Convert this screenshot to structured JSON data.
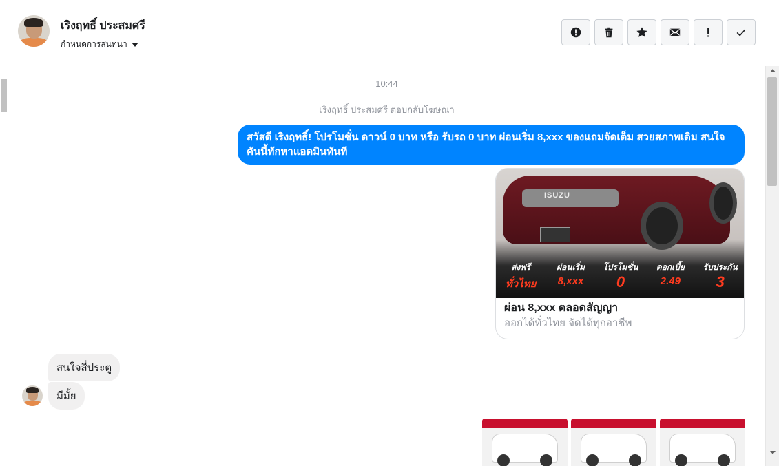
{
  "header": {
    "contact_name": "เริงฤทธิ์ ประสมศรี",
    "conversation_menu_label": "กำหนดการสนทนา",
    "toolbar": [
      {
        "name": "report-button",
        "icon": "alert-circle-icon"
      },
      {
        "name": "delete-button",
        "icon": "trash-icon"
      },
      {
        "name": "star-button",
        "icon": "star-icon"
      },
      {
        "name": "mark-unread-button",
        "icon": "envelope-icon"
      },
      {
        "name": "important-button",
        "icon": "exclamation-icon"
      },
      {
        "name": "done-button",
        "icon": "check-icon"
      }
    ]
  },
  "thread": {
    "timestamp": "10:44",
    "ad_reply_notice": "เริงฤทธิ์ ประสมศรี ตอบกลับโฆษณา",
    "outgoing_message": "สวัสดี เริงฤทธิ์! โปรโมชั่น ดาวน์ 0 บาท หรือ รับรถ 0 บาท ผ่อนเริ่ม 8,xxx ของแถมจัดเต็ม สวยสภาพเดิม สนใจคันนี้ทักหาแอดมินทันที",
    "ad_card": {
      "brand_logo": "ISUZU",
      "promo": [
        {
          "top": "ส่งฟรี",
          "bottom": "ทั่วไทย"
        },
        {
          "top": "ผ่อนเริ่ม",
          "bottom": "8,xxx"
        },
        {
          "top": "โปรโมชั่น",
          "bottom": "0"
        },
        {
          "top": "ดอกเบี้ย",
          "bottom": "2.49"
        },
        {
          "top": "รับประกัน",
          "bottom": "3"
        }
      ],
      "title": "ผ่อน 8,xxx ตลอดสัญญา",
      "subtitle": "ออกได้ทั่วไทย จัดได้ทุกอาชีพ"
    },
    "incoming_messages": [
      "สนใจสี่ประตู",
      "มีมั้ย"
    ]
  },
  "colors": {
    "accent_blue": "#0084ff",
    "incoming_bubble": "#f1f0f0",
    "promo_red": "#ff3b1f"
  }
}
